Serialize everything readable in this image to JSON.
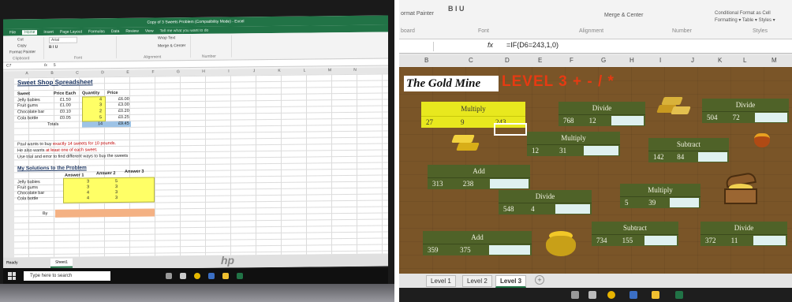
{
  "left": {
    "window_title": "Copy of 3 Sweets Problem (Compatibility Mode) - Excel",
    "tabs": [
      "File",
      "Home",
      "Insert",
      "Page Layout",
      "Formulas",
      "Data",
      "Review",
      "View"
    ],
    "active_tab": "Home",
    "tell_me": "Tell me what you want to do",
    "clipboard": {
      "cut": "Cut",
      "copy": "Copy",
      "format_painter": "Format Painter",
      "label": "Clipboard"
    },
    "font_name": "Arial",
    "wrap_text": "Wrap Text",
    "merge_center": "Merge & Center",
    "group_labels": [
      "Font",
      "Alignment",
      "Number"
    ],
    "name_box": "C7",
    "formula": "5",
    "columns": [
      "A",
      "B",
      "C",
      "D",
      "E",
      "F",
      "G",
      "H",
      "I",
      "J",
      "K",
      "L",
      "M",
      "N",
      "O"
    ],
    "title": "Sweet Shop Spreadsheet",
    "headers": [
      "Sweet",
      "Price Each",
      "Quantity",
      "Price"
    ],
    "rows": [
      {
        "sweet": "Jelly babies",
        "price_each": "£1.50",
        "qty": "4",
        "price": "£6.00"
      },
      {
        "sweet": "Fruit gums",
        "price_each": "£1.00",
        "qty": "3",
        "price": "£3.00"
      },
      {
        "sweet": "Chocolate bar",
        "price_each": "£0.10",
        "qty": "2",
        "price": "£0.20"
      },
      {
        "sweet": "Cola bottle",
        "price_each": "£0.05",
        "qty": "5",
        "price": "£0.25"
      }
    ],
    "totals_label": "Totals",
    "total_qty": "14",
    "total_price": "£9.45",
    "instructions": [
      {
        "text": "Paul wants to buy ",
        "highlight": "exactly 14 sweets for 10 pounds."
      },
      {
        "text": "He also wants ",
        "highlight": "at least one of each sweet."
      },
      {
        "text": "Use trial and error to find different ways to buy the sweets",
        "highlight": ""
      }
    ],
    "solutions_title": "My Solutions to the Problem",
    "answer_headers": [
      "Answer 1",
      "Answer 2",
      "Answer 3"
    ],
    "solution_rows": [
      "Jelly babies",
      "Fruit gums",
      "Chocolate bar",
      "Cola bottle"
    ],
    "answer1": [
      "3",
      "3",
      "4",
      "4"
    ],
    "answer2": [
      "5",
      "3",
      "3",
      "3"
    ],
    "by_label": "By",
    "sheet_tab": "Sheet1",
    "status": "Ready",
    "search_placeholder": "Type here to search",
    "brand": "hp"
  },
  "right": {
    "clipboard_label": "ormat Painter",
    "board_label": "board",
    "font_label": "Font",
    "alignment_label": "Alignment",
    "number_label": "Number",
    "styles_label": "Styles",
    "merge_center": "Merge & Center",
    "cond_format": "Conditional Format as Cell",
    "cond_format2": "Formatting ▾  Table ▾  Styles ▾",
    "formula": "=IF(D6=243,1,0)",
    "columns": [
      "B",
      "C",
      "D",
      "E",
      "F",
      "G",
      "H",
      "I",
      "J",
      "K",
      "L",
      "M"
    ],
    "title": "The Gold Mine",
    "level": "LEVEL 3  + - / *",
    "puzzles": [
      {
        "op": "Multiply",
        "a": "27",
        "b": "9",
        "ans": "243"
      },
      {
        "op": "Divide",
        "a": "768",
        "b": "12",
        "ans": ""
      },
      {
        "op": "Divide",
        "a": "504",
        "b": "72",
        "ans": ""
      },
      {
        "op": "Multiply",
        "a": "12",
        "b": "31",
        "ans": ""
      },
      {
        "op": "Subtract",
        "a": "142",
        "b": "84",
        "ans": ""
      },
      {
        "op": "Add",
        "a": "313",
        "b": "238",
        "ans": ""
      },
      {
        "op": "Divide",
        "a": "548",
        "b": "4",
        "ans": ""
      },
      {
        "op": "Multiply",
        "a": "5",
        "b": "39",
        "ans": ""
      },
      {
        "op": "Add",
        "a": "359",
        "b": "375",
        "ans": ""
      },
      {
        "op": "Subtract",
        "a": "734",
        "b": "155",
        "ans": ""
      },
      {
        "op": "Divide",
        "a": "372",
        "b": "11",
        "ans": ""
      }
    ],
    "sheet_tabs": [
      "Level 1",
      "Level 2",
      "Level 3"
    ],
    "active_sheet": "Level 3",
    "colors": {
      "board": "#7a5528",
      "puzzle": "#4f6228",
      "highlight": "#e8e81e",
      "level": "#e63a12"
    }
  }
}
